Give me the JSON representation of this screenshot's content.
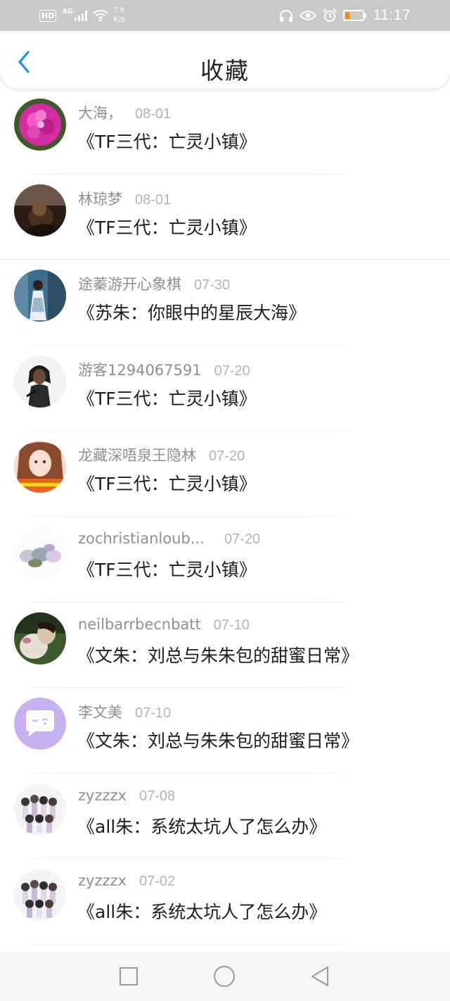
{
  "status_bar": {
    "hd": "HD",
    "network": "4G",
    "speed_value": "7.6",
    "speed_unit": "K/s",
    "time": "11:17",
    "icons": [
      "headphones-icon",
      "eye-icon",
      "alarm-icon",
      "battery-icon"
    ],
    "battery_color": "#ff8a00"
  },
  "header": {
    "title": "收藏",
    "back_icon": "chevron-left-icon",
    "accent": "#1a8cff"
  },
  "favorites": [
    {
      "user": "大海，",
      "date": "08-01",
      "title": "《TF三代：亡灵小镇》"
    },
    {
      "user": "林琼梦",
      "date": "08-01",
      "title": "《TF三代：亡灵小镇》"
    },
    {
      "user": "途蓁游开心象棋",
      "date": "07-30",
      "title": "《苏朱：你眼中的星辰大海》"
    },
    {
      "user": "游客1294067591",
      "date": "07-20",
      "title": "《TF三代：亡灵小镇》"
    },
    {
      "user": "龙藏深唔泉王隐林",
      "date": "07-20",
      "title": "《TF三代：亡灵小镇》"
    },
    {
      "user": "zochristianloub...",
      "date": "07-20",
      "title": "《TF三代：亡灵小镇》"
    },
    {
      "user": "neilbarrbecnbatt",
      "date": "07-10",
      "title": "《文朱：刘总与朱朱包的甜蜜日常》"
    },
    {
      "user": "李文美",
      "date": "07-10",
      "title": "《文朱：刘总与朱朱包的甜蜜日常》"
    },
    {
      "user": "zyzzzx",
      "date": "07-08",
      "title": "《all朱：系统太坑人了怎么办》"
    },
    {
      "user": "zyzzzx",
      "date": "07-02",
      "title": "《all朱：系统太坑人了怎么办》"
    }
  ],
  "nav_bar": {
    "icons": [
      "square-recents-icon",
      "circle-home-icon",
      "triangle-back-icon"
    ]
  }
}
